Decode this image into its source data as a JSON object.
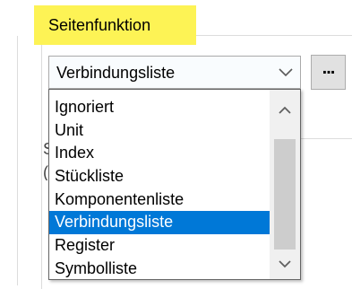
{
  "groupbox": {
    "title": "Seitenfunktion"
  },
  "combo": {
    "selected_value": "Verbindungsliste",
    "chevron_icon": "chevron-down-icon"
  },
  "dots_button": {
    "label": "..."
  },
  "partial_labels": {
    "a": "S",
    "b": "("
  },
  "dropdown": {
    "items": [
      {
        "label": "Ignoriert",
        "selected": false
      },
      {
        "label": "Unit",
        "selected": false
      },
      {
        "label": "Index",
        "selected": false
      },
      {
        "label": "Stückliste",
        "selected": false
      },
      {
        "label": "Komponentenliste",
        "selected": false
      },
      {
        "label": "Verbindungsliste",
        "selected": true
      },
      {
        "label": "Register",
        "selected": false
      },
      {
        "label": "Symbolliste",
        "selected": false
      }
    ],
    "scroll_up_icon": "chevron-up-icon",
    "scroll_down_icon": "chevron-down-icon"
  },
  "colors": {
    "highlight": "#fdf355",
    "selection": "#0078d7",
    "selection_text": "#ffffff"
  }
}
